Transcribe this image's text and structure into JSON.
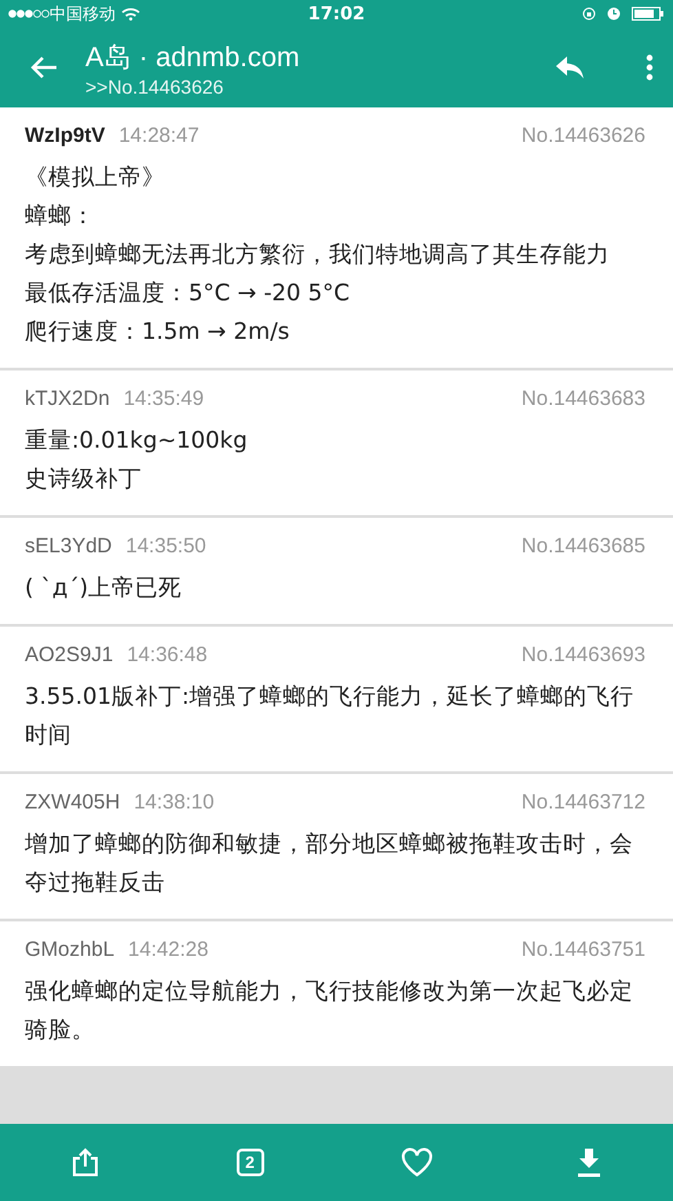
{
  "status_bar": {
    "carrier": "中国移动",
    "time": "17:02"
  },
  "header": {
    "title": "A岛 · adnmb.com",
    "subtitle": ">>No.14463626"
  },
  "posts": [
    {
      "author": "WzIp9tV",
      "is_op": true,
      "time": "14:28:47",
      "number": "No.14463626",
      "lines": [
        "《模拟上帝》",
        "蟑螂：",
        "考虑到蟑螂无法再北方繁衍，我们特地调高了其生存能力",
        "最低存活温度：5°C → -20 5°C",
        "爬行速度：1.5m → 2m/s"
      ]
    },
    {
      "author": "kTJX2Dn",
      "is_op": false,
      "time": "14:35:49",
      "number": "No.14463683",
      "lines": [
        "重量:0.01kg~100kg",
        "史诗级补丁"
      ]
    },
    {
      "author": "sEL3YdD",
      "is_op": false,
      "time": "14:35:50",
      "number": "No.14463685",
      "lines": [
        "( `д´)上帝已死"
      ]
    },
    {
      "author": "AO2S9J1",
      "is_op": false,
      "time": "14:36:48",
      "number": "No.14463693",
      "lines": [
        "3.55.01版补丁:增强了蟑螂的飞行能力，延长了蟑螂的飞行时间"
      ]
    },
    {
      "author": "ZXW405H",
      "is_op": false,
      "time": "14:38:10",
      "number": "No.14463712",
      "lines": [
        "增加了蟑螂的防御和敏捷，部分地区蟑螂被拖鞋攻击时，会夺过拖鞋反击"
      ]
    },
    {
      "author": "GMozhbL",
      "is_op": false,
      "time": "14:42:28",
      "number": "No.14463751",
      "lines": [
        "强化蟑螂的定位导航能力，飞行技能修改为第一次起飞必定骑脸。"
      ]
    }
  ],
  "bottom_bar": {
    "page": "2"
  }
}
